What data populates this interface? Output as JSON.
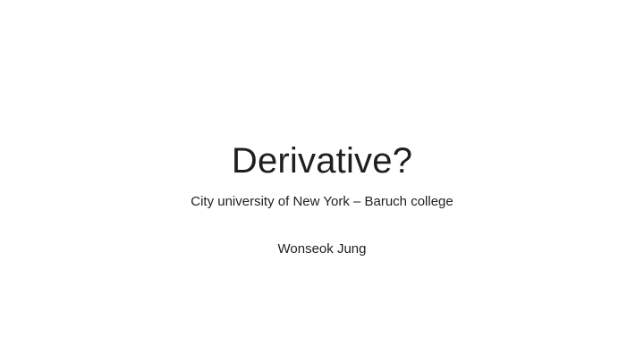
{
  "slide": {
    "title": "Derivative?",
    "subtitle_lines": [
      "City university of New York – Baruch college",
      "Wonseok Jung"
    ]
  }
}
